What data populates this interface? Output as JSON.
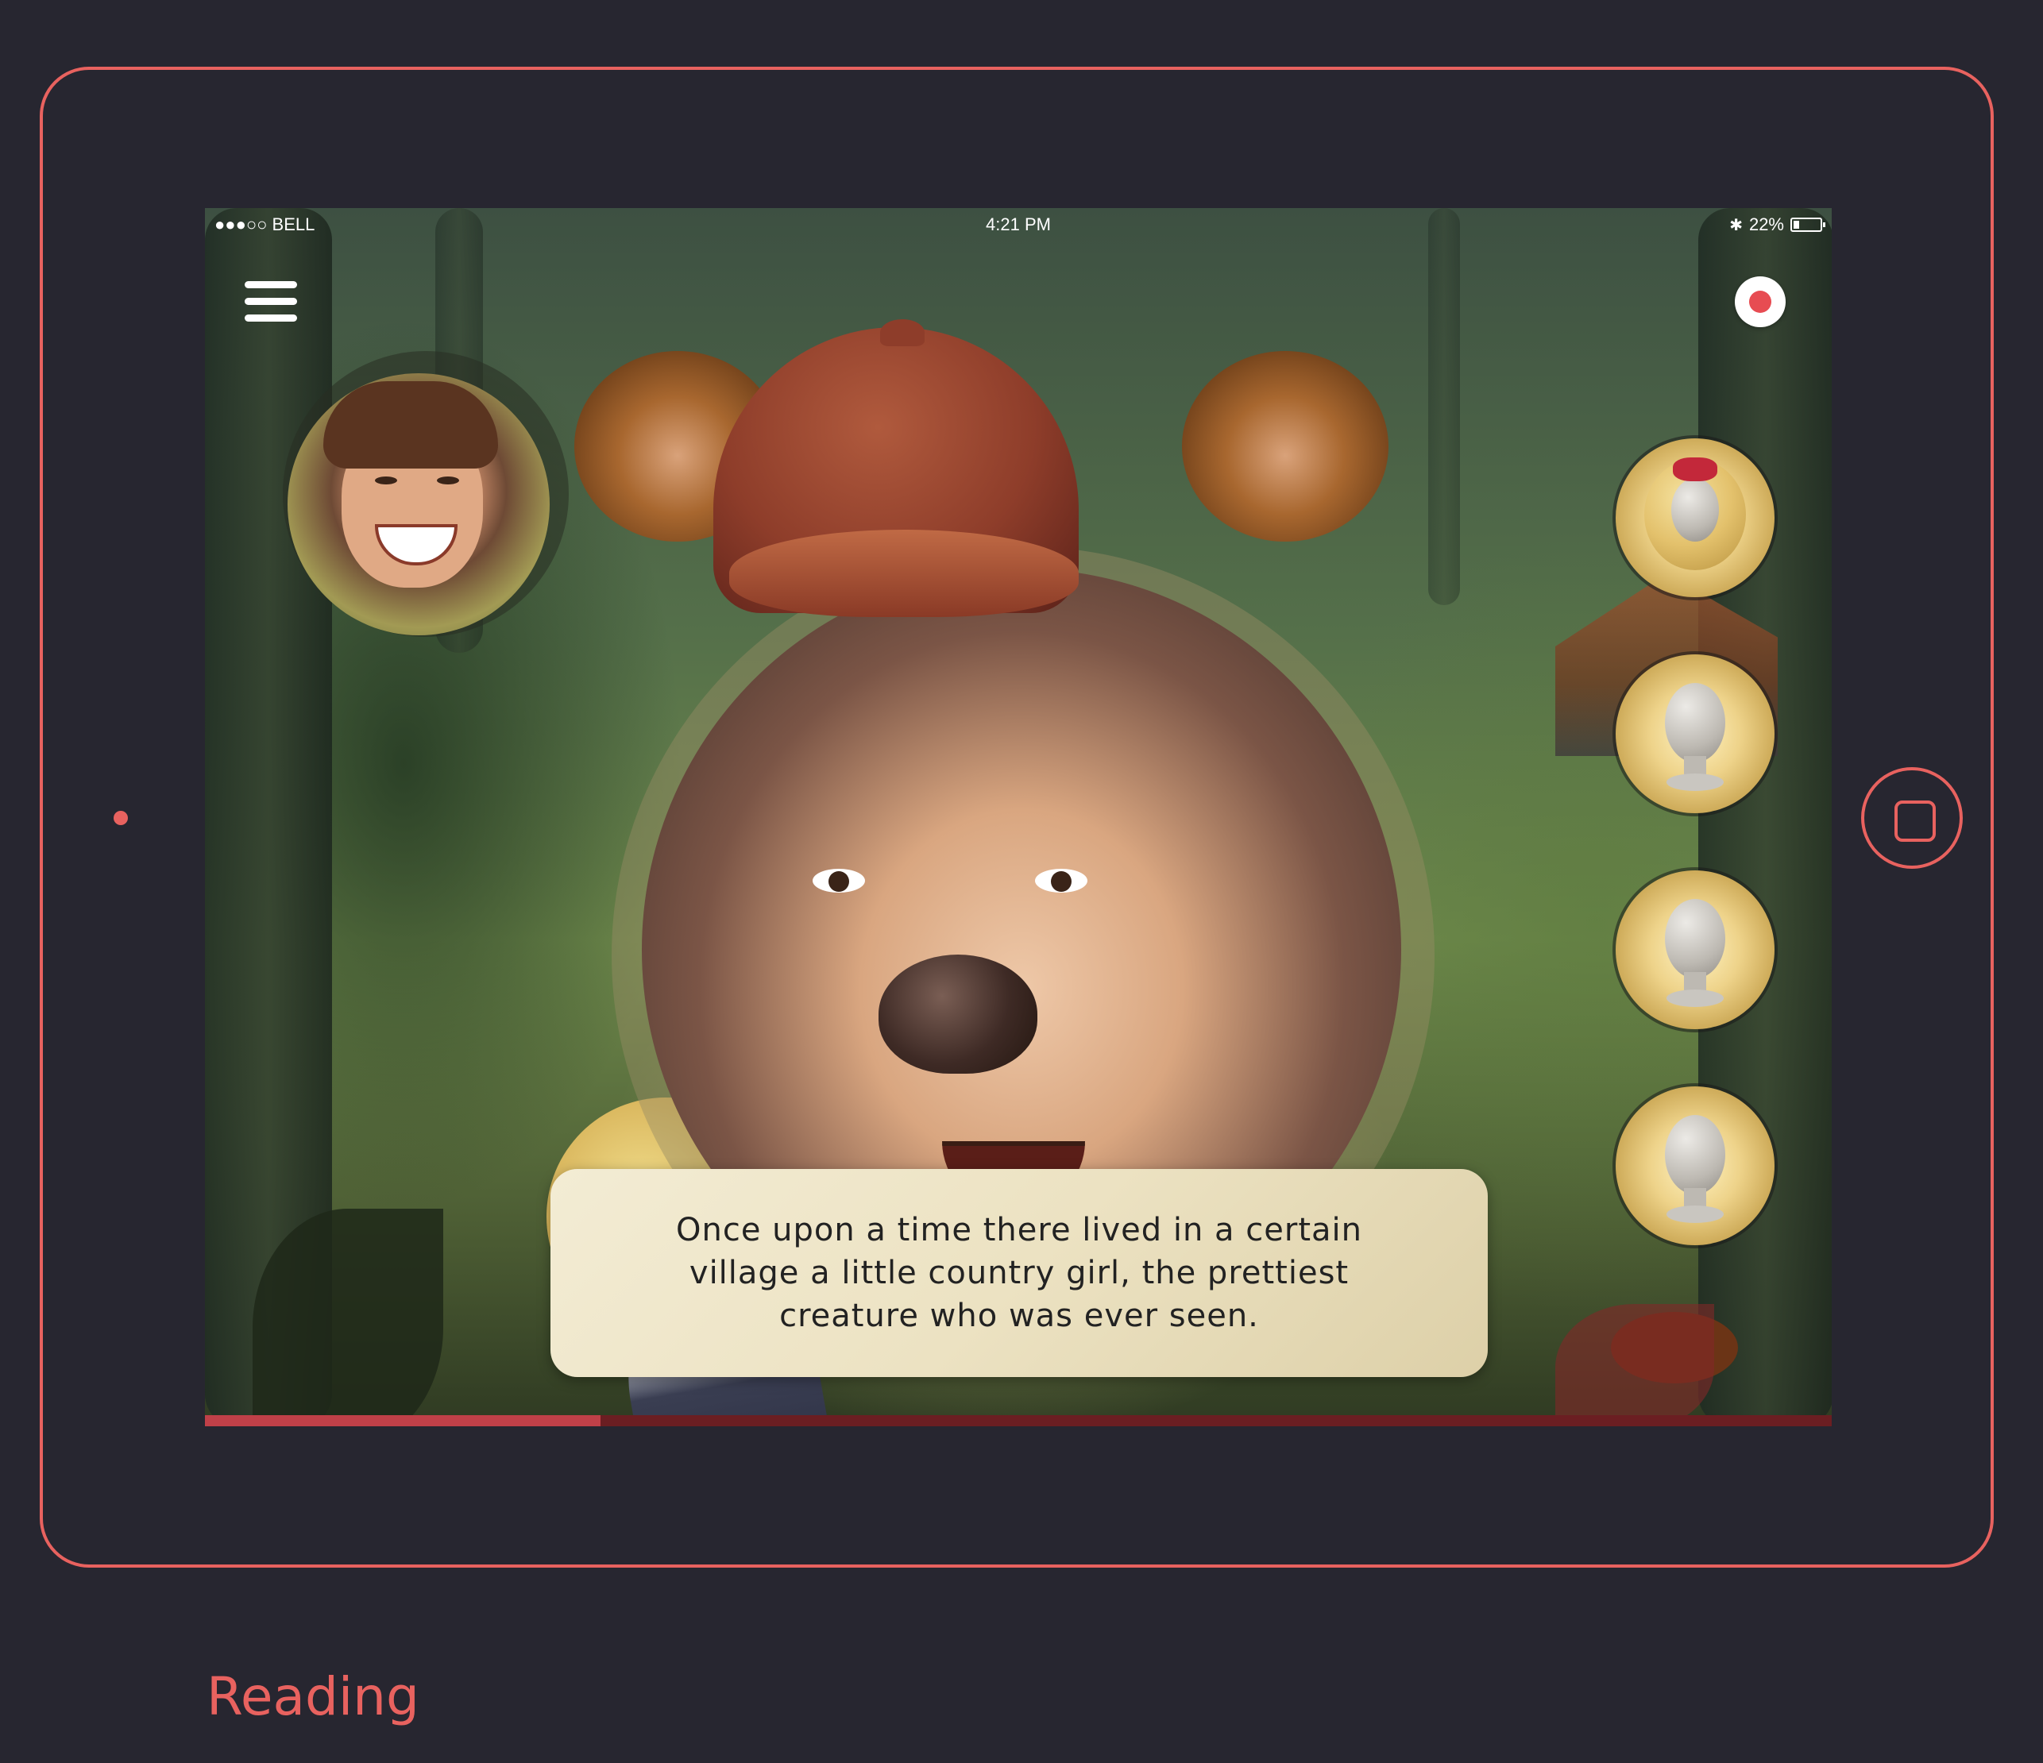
{
  "status_bar": {
    "carrier": "●●●○○ BELL",
    "time": "4:21 PM",
    "battery_text": "22%",
    "battery_level": 0.22
  },
  "icons": {
    "menu": "menu-icon",
    "record": "record-icon",
    "wifi": "wifi-icon",
    "bluetooth": "bluetooth-icon",
    "battery": "battery-icon",
    "home": "home-button-icon"
  },
  "story": {
    "text": "Once upon a time there lived in a certain village a little country girl, the prettiest creature who was ever seen."
  },
  "masks": [
    {
      "name": "goldilocks-wig-mask",
      "selected": true
    },
    {
      "name": "blank-mask-2",
      "selected": false
    },
    {
      "name": "blank-mask-3",
      "selected": false
    },
    {
      "name": "blank-mask-4",
      "selected": false
    }
  ],
  "progress": {
    "fraction": 0.243
  },
  "caption": "Reading",
  "colors": {
    "accent": "#e8625f",
    "background": "#272630",
    "record_red": "#e74c52",
    "progress_fill": "#c04048",
    "progress_track": "#6b1e22"
  }
}
